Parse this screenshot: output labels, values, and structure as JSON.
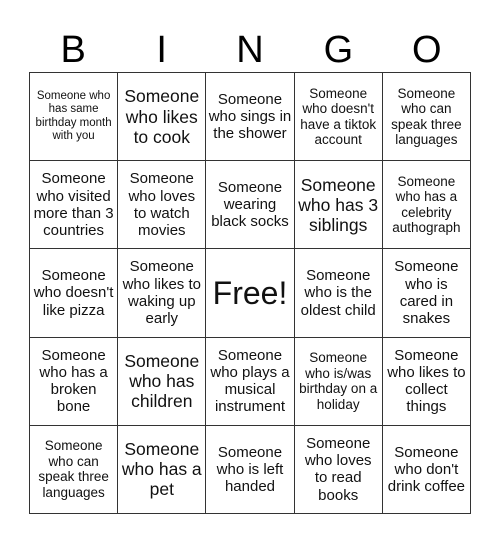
{
  "header": {
    "letters": [
      "B",
      "I",
      "N",
      "G",
      "O"
    ]
  },
  "grid": {
    "rows": [
      [
        "Someone who has same birthday month with you",
        "Someone who likes to cook",
        "Someone who sings in the shower",
        "Someone who doesn't have a tiktok account",
        "Someone who can speak three languages"
      ],
      [
        "Someone who visited more than 3 countries",
        "Someone who loves to watch movies",
        "Someone wearing black socks",
        "Someone who has 3 siblings",
        "Someone who has a celebrity authograph"
      ],
      [
        "Someone who doesn't like pizza",
        "Someone who likes to waking up early",
        "Free!",
        "Someone who is the oldest child",
        "Someone who is cared in snakes"
      ],
      [
        "Someone who has a broken bone",
        "Someone who has children",
        "Someone who plays a musical instrument",
        "Someone who is/was birthday on a holiday",
        "Someone who likes to collect things"
      ],
      [
        "Someone who can speak three languages",
        "Someone who has a pet",
        "Someone who is left handed",
        "Someone who loves to read books",
        "Someone who don't drink coffee"
      ]
    ]
  }
}
